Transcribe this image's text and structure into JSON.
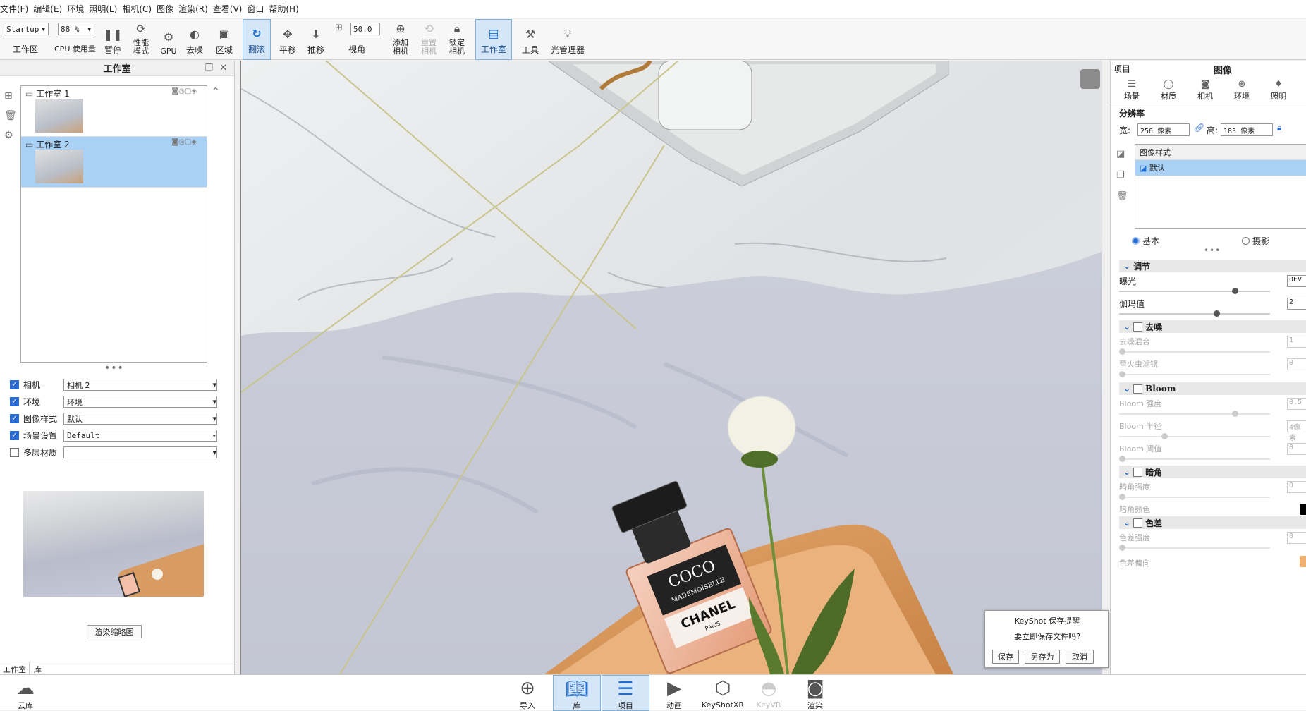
{
  "menu": [
    "文件(F)",
    "编辑(E)",
    "环境",
    "照明(L)",
    "相机(C)",
    "图像",
    "渲染(R)",
    "查看(V)",
    "窗口",
    "帮助(H)"
  ],
  "toolbar": {
    "workspace_select": "Startup",
    "workspace_label": "工作区",
    "cpu_select": "88 %",
    "cpu_label": "CPU 使用量",
    "pause": "暂停",
    "perf": "性能\n模式",
    "gpu": "GPU",
    "denoise": "去噪",
    "region": "区域",
    "tumble": "翻滚",
    "pan": "平移",
    "dolly": "推移",
    "fov_value": "50.0",
    "fov_label": "视角",
    "add_camera": "添加\n相机",
    "reset_camera": "重置\n相机",
    "lock_camera": "锁定\n相机",
    "studio": "工作室",
    "tools": "工具",
    "light_manager": "光管理器"
  },
  "left": {
    "title": "工作室",
    "studios": [
      {
        "name": "工作室 1"
      },
      {
        "name": "工作室 2"
      }
    ],
    "options": [
      {
        "label": "相机",
        "checked": true,
        "value": "相机 2"
      },
      {
        "label": "环境",
        "checked": true,
        "value": "环境"
      },
      {
        "label": "图像样式",
        "checked": true,
        "value": "默认"
      },
      {
        "label": "场景设置",
        "checked": true,
        "value": "Default"
      },
      {
        "label": "多层材质",
        "checked": false,
        "value": ""
      }
    ],
    "render_thumb_btn": "渲染缩略图",
    "tabs": [
      "工作室",
      "库"
    ],
    "cloud_label": "云库"
  },
  "right": {
    "tab_project": "项目",
    "tab_image": "图像",
    "subtabs": [
      "场景",
      "材质",
      "相机",
      "环境",
      "照明"
    ],
    "resolution_title": "分辨率",
    "width_label": "宽:",
    "width_value": "256 像素",
    "height_label": "高:",
    "height_value": "183 像素",
    "style_header": "图像样式",
    "style_item": "默认",
    "mode_basic": "基本",
    "mode_photo": "摄影",
    "sections": {
      "adjust": "调节",
      "exposure_label": "曝光",
      "exposure_value": "0EV",
      "gamma_label": "伽玛值",
      "gamma_value": "2",
      "denoise": "去噪",
      "denoise_mix": "去噪混合",
      "denoise_mix_value": "1",
      "firefly": "萤火虫滤镜",
      "firefly_value": "0",
      "bloom": "Bloom",
      "bloom_strength": "Bloom 强度",
      "bloom_strength_value": "0.5",
      "bloom_radius": "Bloom 半径",
      "bloom_radius_value": "4像素",
      "bloom_threshold": "Bloom 阈值",
      "bloom_threshold_value": "0",
      "vignette": "暗角",
      "vignette_strength": "暗角强度",
      "vignette_strength_value": "0",
      "vignette_color": "暗角颜色",
      "chromatic": "色差",
      "chromatic_strength": "色差强度",
      "chromatic_strength_value": "0",
      "chromatic_shift": "色差偏向"
    }
  },
  "dialog": {
    "title": "KeyShot 保存提醒",
    "message": "要立即保存文件吗?",
    "save": "保存",
    "save_as": "另存为",
    "cancel": "取消"
  },
  "bottom": [
    "导入",
    "库",
    "项目",
    "动画",
    "KeyShotXR",
    "KeyVR",
    "渲染"
  ],
  "product": {
    "brand1": "COCO",
    "brand2": "MADEMOISELLE",
    "brand3": "CHANEL",
    "brand4": "PARIS"
  }
}
